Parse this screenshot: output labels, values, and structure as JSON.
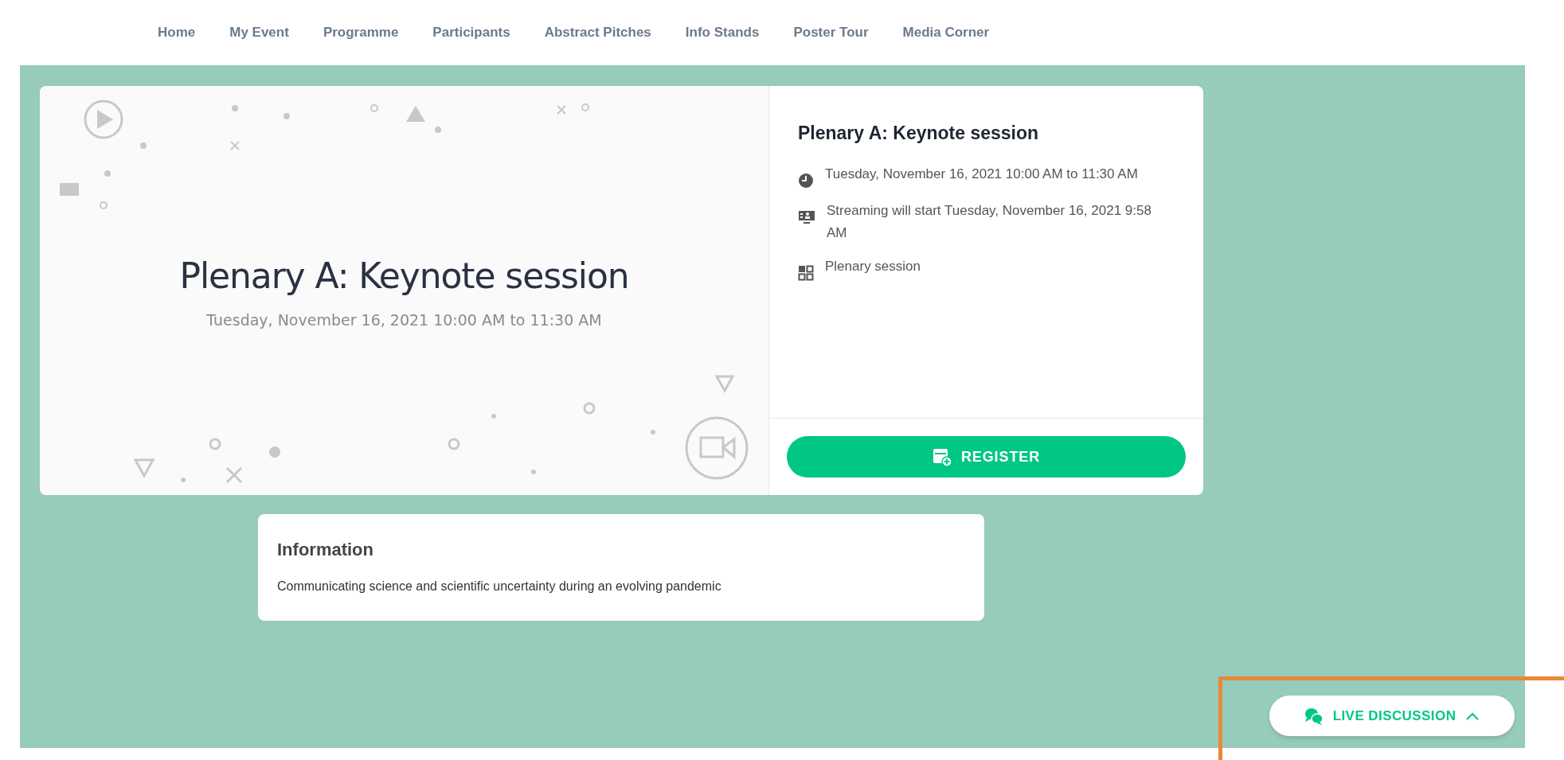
{
  "nav": {
    "items": [
      {
        "label": "Home"
      },
      {
        "label": "My Event"
      },
      {
        "label": "Programme"
      },
      {
        "label": "Participants"
      },
      {
        "label": "Abstract Pitches"
      },
      {
        "label": "Info Stands"
      },
      {
        "label": "Poster Tour"
      },
      {
        "label": "Media Corner"
      }
    ]
  },
  "session": {
    "banner_title": "Plenary A: Keynote session",
    "banner_subtitle": "Tuesday, November 16, 2021 10:00 AM to 11:30 AM",
    "title": "Plenary A: Keynote session",
    "details": [
      {
        "kind": "time",
        "text": "Tuesday, November 16, 2021 10:00 AM to 11:30 AM"
      },
      {
        "kind": "streaming",
        "text": "Streaming will start Tuesday, November 16, 2021 9:58 AM"
      },
      {
        "kind": "category",
        "text": "Plenary session"
      }
    ],
    "register_button": "REGISTER"
  },
  "information": {
    "title": "Information",
    "text": "Communicating science and scientific uncertainty during an evolving pandemic"
  },
  "live_discussion": {
    "label": "LIVE DISCUSSION",
    "expanded": false
  }
}
